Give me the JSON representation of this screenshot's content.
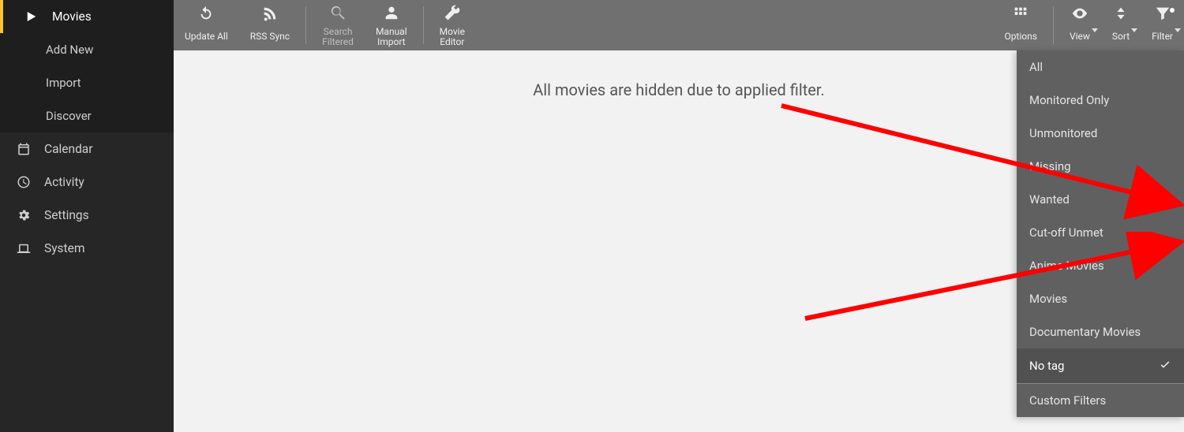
{
  "sidebar": {
    "main": [
      {
        "label": "Movies",
        "icon": "play",
        "active": true,
        "sub": [
          {
            "label": "Add New"
          },
          {
            "label": "Import"
          },
          {
            "label": "Discover"
          }
        ]
      },
      {
        "label": "Calendar",
        "icon": "calendar"
      },
      {
        "label": "Activity",
        "icon": "clock"
      },
      {
        "label": "Settings",
        "icon": "cogs"
      },
      {
        "label": "System",
        "icon": "laptop"
      }
    ]
  },
  "toolbar": {
    "left": [
      {
        "label": "Update All",
        "label2": "",
        "icon": "refresh"
      },
      {
        "label": "RSS Sync",
        "label2": "",
        "icon": "rss"
      },
      {
        "divider": true
      },
      {
        "label": "Search",
        "label2": "Filtered",
        "icon": "search",
        "dim": true
      },
      {
        "label": "Manual",
        "label2": "Import",
        "icon": "user"
      },
      {
        "divider": true
      },
      {
        "label": "Movie",
        "label2": "Editor",
        "icon": "wrench"
      }
    ],
    "right": [
      {
        "label": "Options",
        "icon": "grid"
      },
      {
        "divider": true
      },
      {
        "label": "View",
        "icon": "eye",
        "caret": true
      },
      {
        "label": "Sort",
        "icon": "sort",
        "caret": true
      },
      {
        "label": "Filter",
        "icon": "filter",
        "caret": true,
        "dot": true
      }
    ]
  },
  "content": {
    "empty_message": "All movies are hidden due to applied filter."
  },
  "filter_dropdown": {
    "items": [
      {
        "label": "All"
      },
      {
        "label": "Monitored Only"
      },
      {
        "label": "Unmonitored"
      },
      {
        "label": "Missing"
      },
      {
        "label": "Wanted"
      },
      {
        "label": "Cut-off Unmet"
      },
      {
        "label": "Anime Movies"
      },
      {
        "label": "Movies"
      },
      {
        "label": "Documentary Movies"
      },
      {
        "label": "No tag",
        "selected": true
      }
    ],
    "footer": {
      "label": "Custom Filters"
    }
  }
}
